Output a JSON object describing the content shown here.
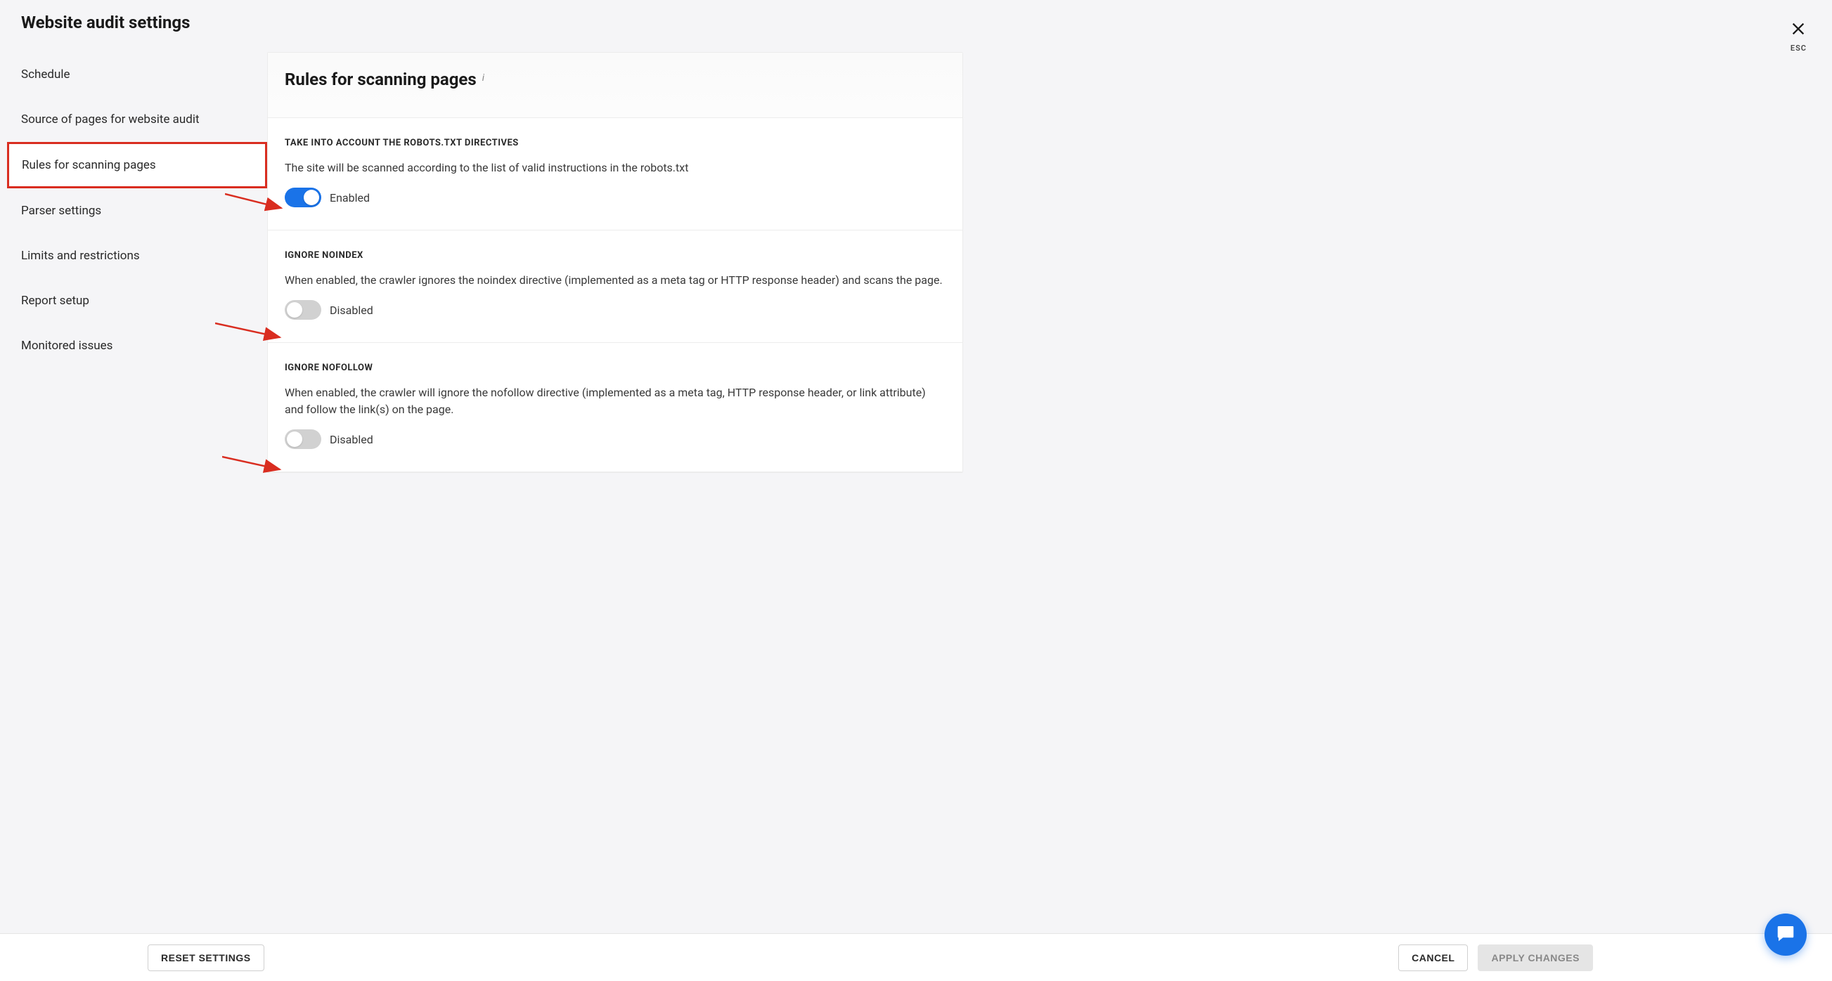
{
  "modal": {
    "title": "Website audit settings",
    "close_label": "ESC"
  },
  "sidebar": {
    "items": [
      {
        "label": "Schedule"
      },
      {
        "label": "Source of pages for website audit"
      },
      {
        "label": "Rules for scanning pages",
        "active": true
      },
      {
        "label": "Parser settings"
      },
      {
        "label": "Limits and restrictions"
      },
      {
        "label": "Report setup"
      },
      {
        "label": "Monitored issues"
      }
    ]
  },
  "main": {
    "title": "Rules for scanning pages",
    "sections": [
      {
        "title": "TAKE INTO ACCOUNT THE ROBOTS.TXT DIRECTIVES",
        "desc": "The site will be scanned according to the list of valid instructions in the robots.txt",
        "enabled": true,
        "toggle_label": "Enabled"
      },
      {
        "title": "IGNORE NOINDEX",
        "desc": "When enabled, the crawler ignores the noindex directive (implemented as a meta tag or HTTP response header) and scans the page.",
        "enabled": false,
        "toggle_label": "Disabled"
      },
      {
        "title": "IGNORE NOFOLLOW",
        "desc": "When enabled, the crawler will ignore the nofollow directive (implemented as a meta tag, HTTP response header, or link attribute) and follow the link(s) on the page.",
        "enabled": false,
        "toggle_label": "Disabled"
      }
    ]
  },
  "footer": {
    "reset": "RESET SETTINGS",
    "cancel": "CANCEL",
    "apply": "APPLY CHANGES"
  }
}
